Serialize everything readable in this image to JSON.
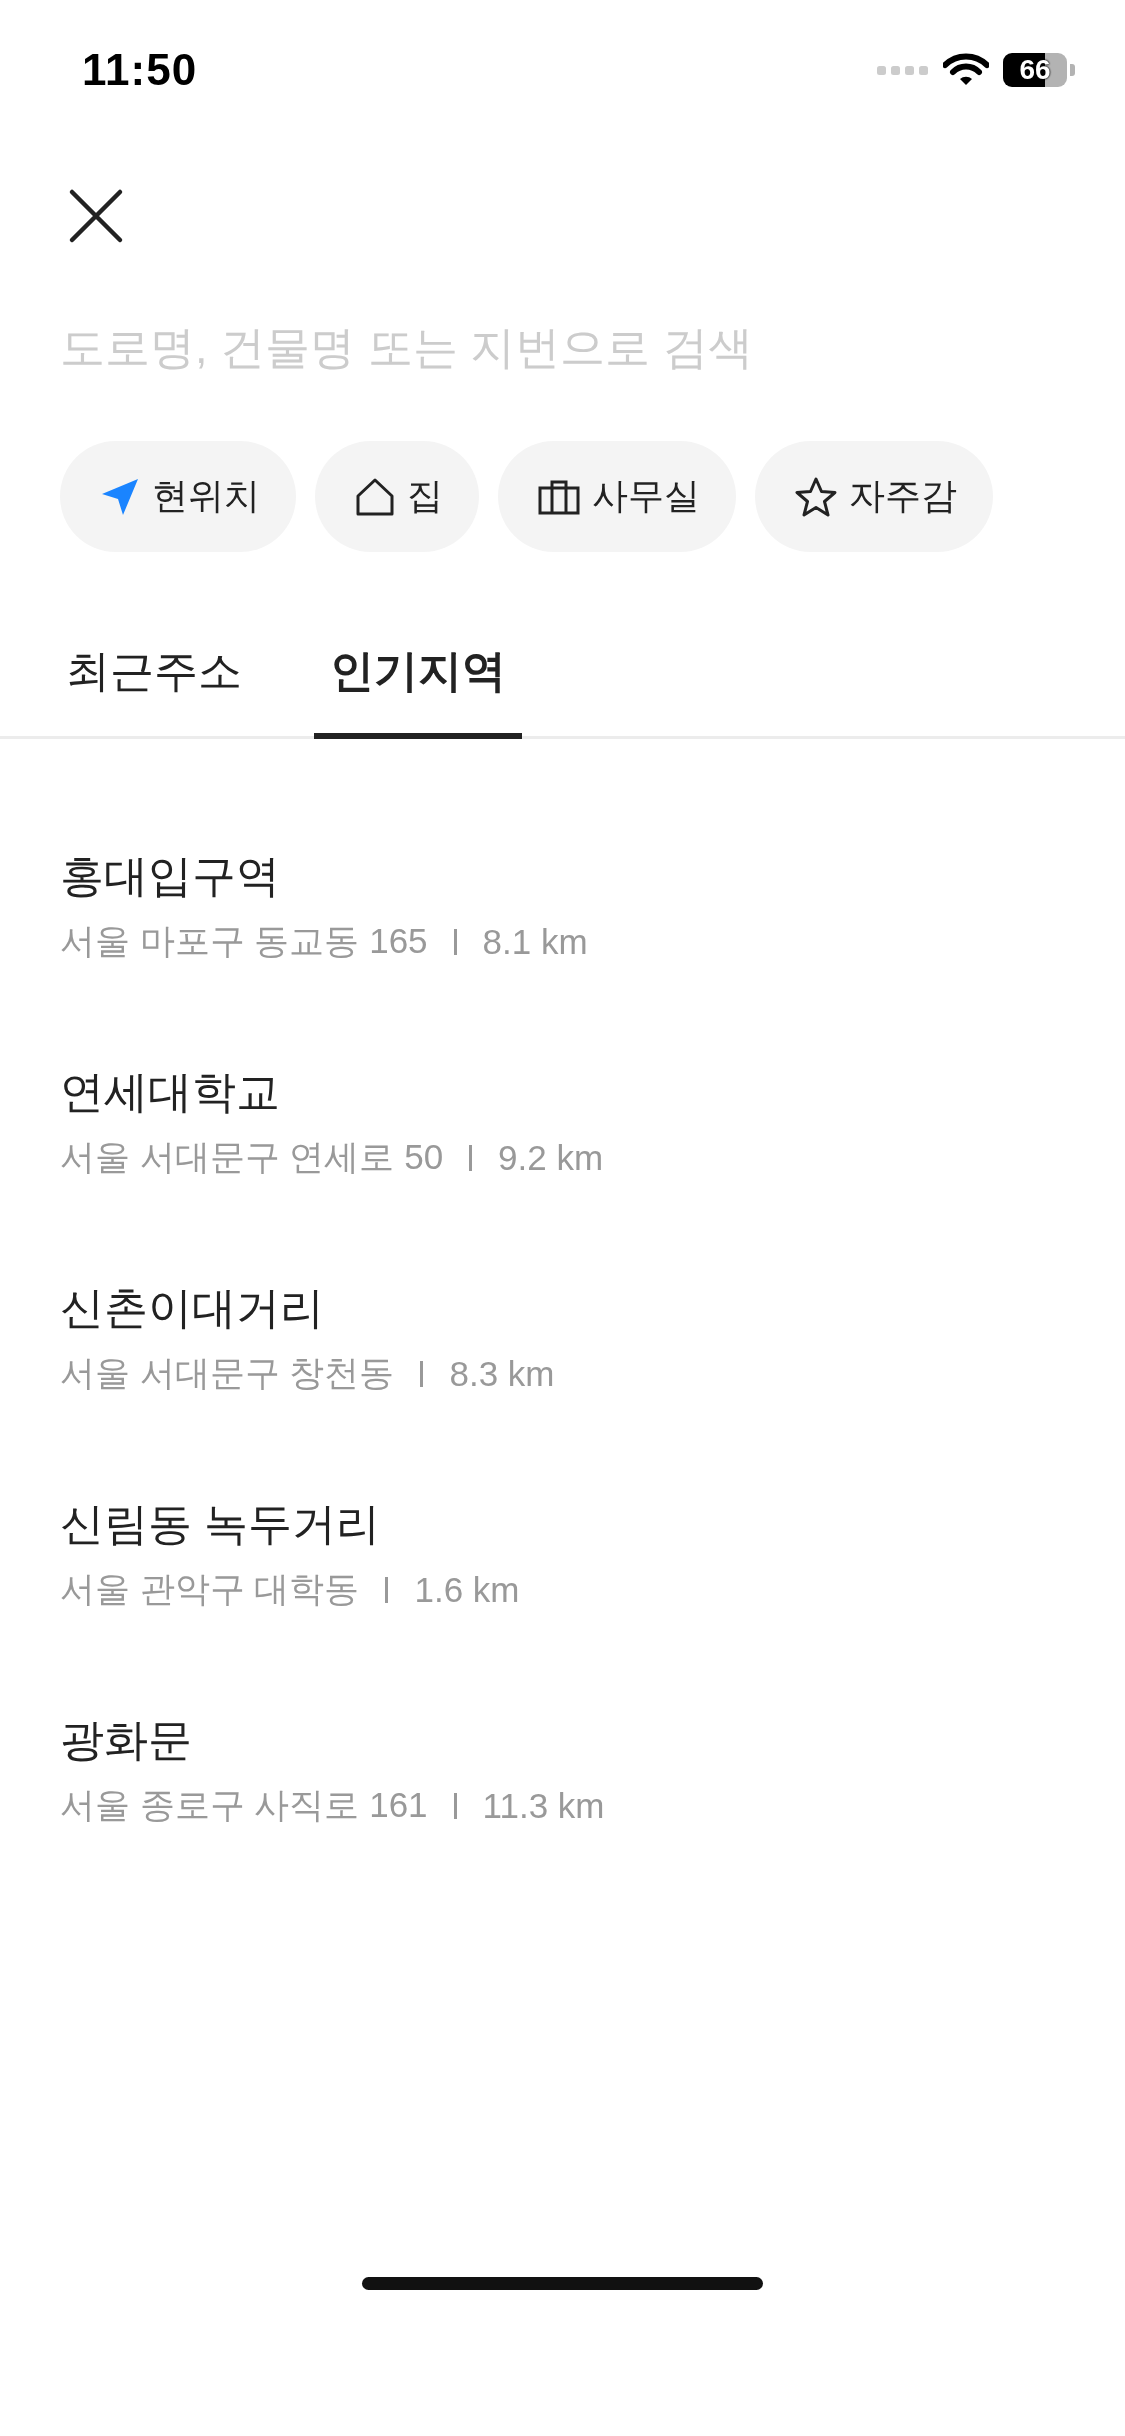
{
  "status_bar": {
    "time": "11:50",
    "battery": "66"
  },
  "search": {
    "placeholder": "도로명, 건물명 또는 지번으로 검색"
  },
  "shortcuts": [
    {
      "kind": "location",
      "label": "현위치"
    },
    {
      "kind": "home",
      "label": "집"
    },
    {
      "kind": "office",
      "label": "사무실"
    },
    {
      "kind": "star",
      "label": "자주감"
    }
  ],
  "tabs": [
    {
      "label": "최근주소",
      "selected": false
    },
    {
      "label": "인기지역",
      "selected": true
    }
  ],
  "places": [
    {
      "name": "홍대입구역",
      "address": "서울 마포구 동교동 165",
      "distance": "8.1 km"
    },
    {
      "name": "연세대학교",
      "address": "서울 서대문구 연세로 50",
      "distance": "9.2 km"
    },
    {
      "name": "신촌이대거리",
      "address": "서울 서대문구 창천동",
      "distance": "8.3 km"
    },
    {
      "name": "신림동 녹두거리",
      "address": "서울 관악구 대학동",
      "distance": "1.6 km"
    },
    {
      "name": "광화문",
      "address": "서울 종로구 사직로 161",
      "distance": "11.3 km"
    }
  ]
}
